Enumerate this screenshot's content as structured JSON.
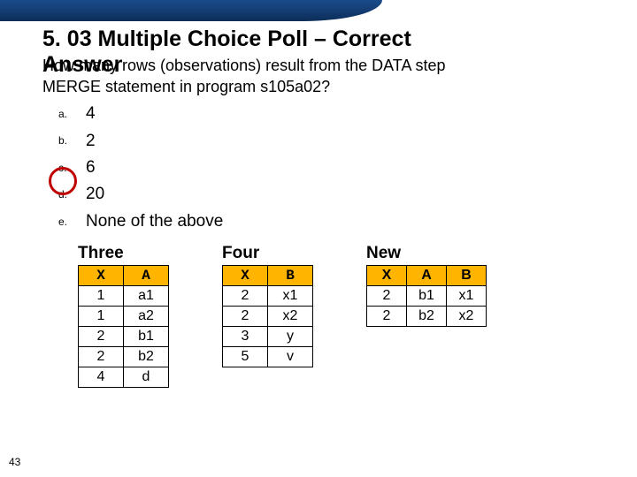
{
  "title_line1": "5. 03 Multiple Choice Poll – Correct",
  "title_line2": "Answer",
  "question_line1": "How many rows (observations) result from the DATA step",
  "question_line2": "MERGE statement in program s105a02?",
  "options": {
    "a": {
      "label": "a.",
      "value": "4"
    },
    "b": {
      "label": "b.",
      "value": "2"
    },
    "c": {
      "label": "c.",
      "value": "6"
    },
    "d": {
      "label": "d.",
      "value": "20"
    },
    "e": {
      "label": "e.",
      "value": "None of the above"
    }
  },
  "circled": "b",
  "tables": {
    "three": {
      "name": "Three",
      "headers": [
        "X",
        "A"
      ],
      "rows": [
        [
          "1",
          "a1"
        ],
        [
          "1",
          "a2"
        ],
        [
          "2",
          "b1"
        ],
        [
          "2",
          "b2"
        ],
        [
          "4",
          "d"
        ]
      ]
    },
    "four": {
      "name": "Four",
      "headers": [
        "X",
        "B"
      ],
      "rows": [
        [
          "2",
          "x1"
        ],
        [
          "2",
          "x2"
        ],
        [
          "3",
          "y"
        ],
        [
          "5",
          "v"
        ]
      ]
    },
    "new": {
      "name": "New",
      "headers": [
        "X",
        "A",
        "B"
      ],
      "rows": [
        [
          "2",
          "b1",
          "x1"
        ],
        [
          "2",
          "b2",
          "x2"
        ]
      ]
    }
  },
  "page": "43"
}
